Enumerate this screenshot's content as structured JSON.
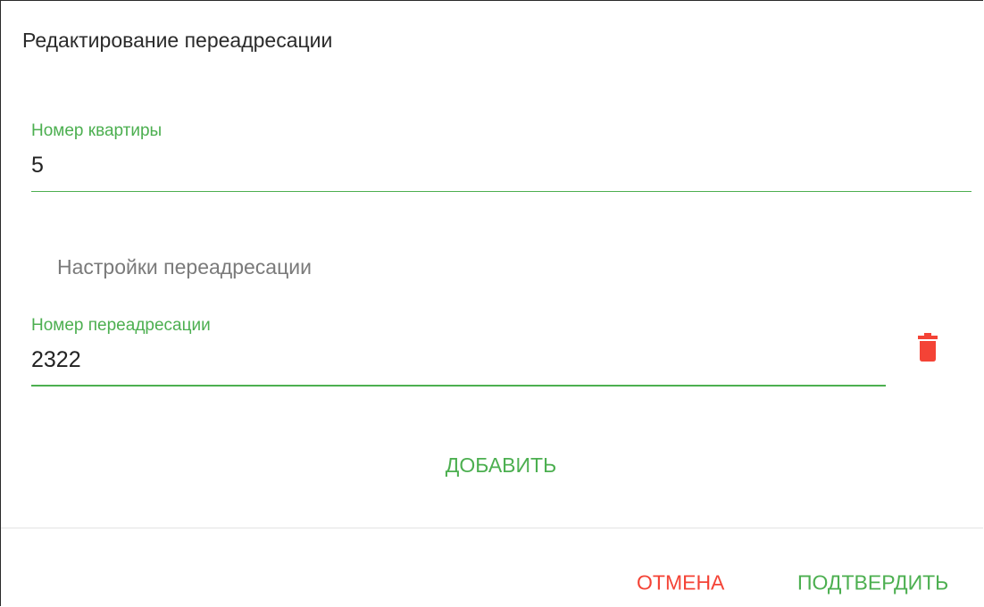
{
  "dialog": {
    "title": "Редактирование переадресации"
  },
  "apartment_field": {
    "label": "Номер квартиры",
    "value": "5"
  },
  "redirect_settings": {
    "section_title": "Настройки переадресации",
    "redirect_field": {
      "label": "Номер переадресации",
      "value": "2322"
    },
    "delete_icon": "trash-icon",
    "add_label": "ДОБАВИТЬ"
  },
  "actions": {
    "cancel_label": "ОТМЕНА",
    "confirm_label": "ПОДТВЕРДИТЬ"
  },
  "colors": {
    "accent": "#4caf50",
    "danger": "#f44336",
    "text": "#222222",
    "muted": "#7a7a7a"
  }
}
